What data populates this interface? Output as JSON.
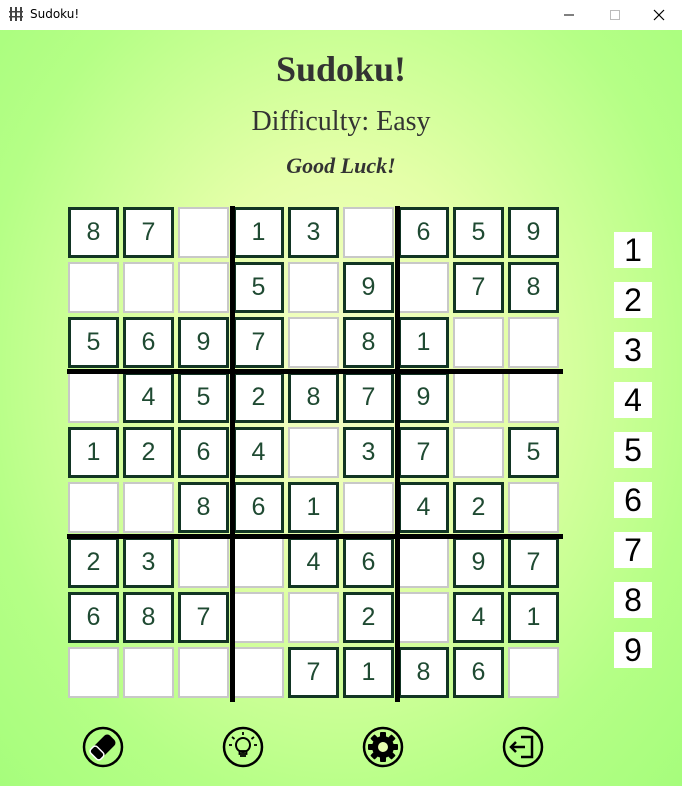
{
  "window": {
    "title": "Sudoku!"
  },
  "header": {
    "title": "Sudoku!",
    "difficulty": "Difficulty: Easy",
    "greeting": "Good Luck!"
  },
  "board": {
    "rows": [
      [
        "8",
        "7",
        "",
        "1",
        "3",
        "",
        "6",
        "5",
        "9"
      ],
      [
        "",
        "",
        "",
        "5",
        "",
        "9",
        "",
        "7",
        "8"
      ],
      [
        "5",
        "6",
        "9",
        "7",
        "",
        "8",
        "1",
        "",
        ""
      ],
      [
        "",
        "4",
        "5",
        "2",
        "8",
        "7",
        "9",
        "",
        ""
      ],
      [
        "1",
        "2",
        "6",
        "4",
        "",
        "3",
        "7",
        "",
        "5"
      ],
      [
        "",
        "",
        "8",
        "6",
        "1",
        "",
        "4",
        "2",
        ""
      ],
      [
        "2",
        "3",
        "",
        "",
        "4",
        "6",
        "",
        "9",
        "7"
      ],
      [
        "6",
        "8",
        "7",
        "",
        "",
        "2",
        "",
        "4",
        "1"
      ],
      [
        "",
        "",
        "",
        "",
        "7",
        "1",
        "8",
        "6",
        ""
      ]
    ]
  },
  "numpad": [
    "1",
    "2",
    "3",
    "4",
    "5",
    "6",
    "7",
    "8",
    "9"
  ],
  "toolbar": {
    "icons": [
      "eraser-icon",
      "hint-lightbulb-icon",
      "settings-gear-icon",
      "exit-icon"
    ]
  },
  "colors": {
    "background_center": "#f6ffc8",
    "background_edge": "#a6fd7c",
    "given_border": "#123524",
    "empty_border": "#c8c8c8",
    "digit": "#1f4a32"
  }
}
